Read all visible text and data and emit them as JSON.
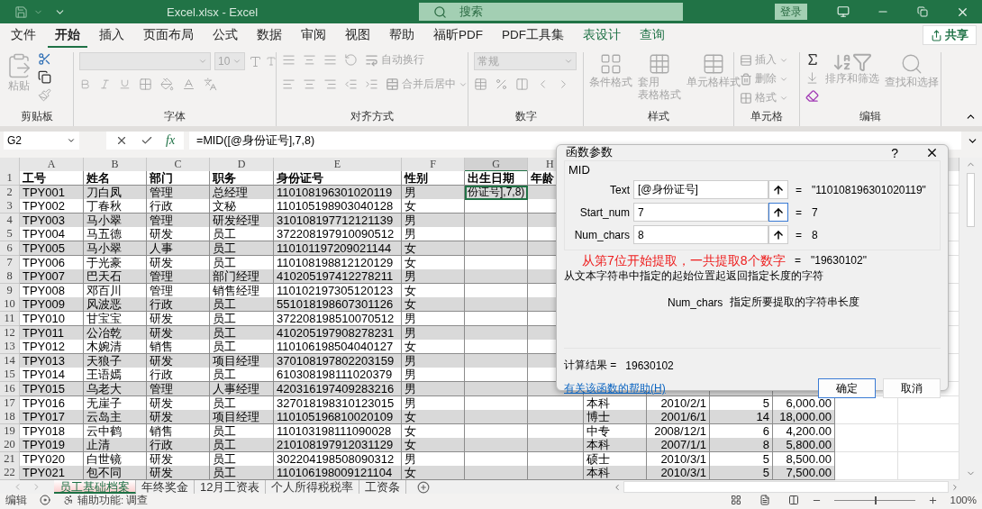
{
  "title_bar": {
    "title": "Excel.xlsx  -  Excel",
    "search": {
      "placeholder": "搜索"
    },
    "sign_in": "登录"
  },
  "menu": {
    "tabs": [
      {
        "label": "文件",
        "selected": false,
        "contextual": false
      },
      {
        "label": "开始",
        "selected": true,
        "contextual": false
      },
      {
        "label": "插入",
        "selected": false,
        "contextual": false
      },
      {
        "label": "页面布局",
        "selected": false,
        "contextual": false
      },
      {
        "label": "公式",
        "selected": false,
        "contextual": false
      },
      {
        "label": "数据",
        "selected": false,
        "contextual": false
      },
      {
        "label": "审阅",
        "selected": false,
        "contextual": false
      },
      {
        "label": "视图",
        "selected": false,
        "contextual": false
      },
      {
        "label": "帮助",
        "selected": false,
        "contextual": false
      },
      {
        "label": "福昕PDF",
        "selected": false,
        "contextual": false
      },
      {
        "label": "PDF工具集",
        "selected": false,
        "contextual": false
      },
      {
        "label": "表设计",
        "selected": false,
        "contextual": true
      },
      {
        "label": "查询",
        "selected": false,
        "contextual": true
      }
    ],
    "share": "共享"
  },
  "ribbon": {
    "groups": [
      {
        "kind": "clipboard",
        "title": "剪贴板",
        "paste": "粘贴",
        "disabled": true
      },
      {
        "kind": "font",
        "title": "字体",
        "size": "10",
        "disabled": true
      },
      {
        "kind": "alignment",
        "title": "对齐方式",
        "wrap": "自动换行",
        "merge": "合并后居中",
        "disabled": true
      },
      {
        "kind": "number",
        "title": "数字",
        "format": "常规",
        "disabled": true
      },
      {
        "kind": "styles",
        "title": "样式",
        "buttons": [
          [
            "条件格式"
          ],
          [
            "套用",
            "表格格式"
          ],
          [
            "单元格样式"
          ]
        ],
        "disabled": true
      },
      {
        "kind": "cells",
        "title": "单元格",
        "buttons": [
          "插入",
          "删除",
          "格式"
        ],
        "disabled": true
      },
      {
        "kind": "editing",
        "title": "编辑",
        "sort": "排序和筛选",
        "find": "查找和选择",
        "disabled": true
      }
    ]
  },
  "formula_bar": {
    "name_box": "G2",
    "fx": "fx",
    "formula": "=MID([@身份证号],7,8)"
  },
  "sheet": {
    "columns": [
      {
        "label": "A",
        "selected": false
      },
      {
        "label": "B",
        "selected": false
      },
      {
        "label": "C",
        "selected": false
      },
      {
        "label": "D",
        "selected": false
      },
      {
        "label": "E",
        "selected": false
      },
      {
        "label": "F",
        "selected": false
      },
      {
        "label": "G",
        "selected": true
      },
      {
        "label": "H",
        "selected": false
      }
    ],
    "rows": [
      {
        "number": "1",
        "kind": "header",
        "cells": [
          "工号",
          "姓名",
          "部门",
          "职务",
          "身份证号",
          "性别",
          "出生日期",
          "年龄"
        ]
      },
      {
        "number": "2",
        "kind": "data",
        "cells": [
          "TPY001",
          "刀白凤",
          "管理",
          "总经理",
          "110108196301020119",
          "男",
          {
            "text": "份证号],7,8)",
            "active": true
          },
          null
        ]
      },
      {
        "number": "3",
        "kind": "data",
        "cells": [
          "TPY002",
          "丁春秋",
          "行政",
          "文秘",
          "110105198903040128",
          "女",
          null,
          null
        ]
      },
      {
        "number": "4",
        "kind": "data",
        "cells": [
          "TPY003",
          "马小翠",
          "管理",
          "研发经理",
          "310108197712121139",
          "男",
          null,
          null
        ]
      },
      {
        "number": "5",
        "kind": "data",
        "cells": [
          "TPY004",
          "马五德",
          "研发",
          "员工",
          "372208197910090512",
          "男",
          null,
          null
        ]
      },
      {
        "number": "6",
        "kind": "data",
        "cells": [
          "TPY005",
          "马小翠",
          "人事",
          "员工",
          "110101197209021144",
          "女",
          null,
          null
        ]
      },
      {
        "number": "7",
        "kind": "data",
        "cells": [
          "TPY006",
          "于光豪",
          "研发",
          "员工",
          "110108198812120129",
          "女",
          null,
          null
        ]
      },
      {
        "number": "8",
        "kind": "data",
        "cells": [
          "TPY007",
          "巴天石",
          "管理",
          "部门经理",
          "410205197412278211",
          "男",
          null,
          null
        ]
      },
      {
        "number": "9",
        "kind": "data",
        "cells": [
          "TPY008",
          "邓百川",
          "管理",
          "销售经理",
          "110102197305120123",
          "女",
          null,
          null
        ]
      },
      {
        "number": "10",
        "kind": "data",
        "cells": [
          "TPY009",
          "风波恶",
          "行政",
          "员工",
          "551018198607301126",
          "女",
          null,
          null
        ]
      },
      {
        "number": "11",
        "kind": "data",
        "cells": [
          "TPY010",
          "甘宝宝",
          "研发",
          "员工",
          "372208198510070512",
          "男",
          null,
          null
        ]
      },
      {
        "number": "12",
        "kind": "data",
        "cells": [
          "TPY011",
          "公冶乾",
          "研发",
          "员工",
          "410205197908278231",
          "男",
          null,
          null
        ]
      },
      {
        "number": "13",
        "kind": "data",
        "cells": [
          "TPY012",
          "木婉清",
          "销售",
          "员工",
          "110106198504040127",
          "女",
          null,
          null
        ]
      },
      {
        "number": "14",
        "kind": "data",
        "cells": [
          "TPY013",
          "天狼子",
          "研发",
          "项目经理",
          "370108197802203159",
          "男",
          null,
          null
        ]
      },
      {
        "number": "15",
        "kind": "data",
        "cells": [
          "TPY014",
          "王语嫣",
          "行政",
          "员工",
          "610308198111020379",
          "男",
          null,
          null
        ]
      },
      {
        "number": "16",
        "kind": "data",
        "cells": [
          "TPY015",
          "乌老大",
          "管理",
          "人事经理",
          "420316197409283216",
          "男",
          null,
          null
        ]
      },
      {
        "number": "17",
        "kind": "data",
        "cells": [
          "TPY016",
          "无崖子",
          "研发",
          "员工",
          "327018198310123015",
          "男",
          null,
          null
        ],
        "more": [
          "本科",
          "2010/2/1",
          "5",
          "6,000.00"
        ]
      },
      {
        "number": "18",
        "kind": "data",
        "cells": [
          "TPY017",
          "云岛主",
          "研发",
          "项目经理",
          "110105196810020109",
          "女",
          null,
          null
        ],
        "more": [
          "博士",
          "2001/6/1",
          "14",
          "18,000.00"
        ]
      },
      {
        "number": "19",
        "kind": "data",
        "cells": [
          "TPY018",
          "云中鹤",
          "销售",
          "员工",
          "110103198111090028",
          "女",
          null,
          null
        ],
        "more": [
          "中专",
          "2008/12/1",
          "6",
          "4,200.00"
        ]
      },
      {
        "number": "20",
        "kind": "data",
        "cells": [
          "TPY019",
          "止清",
          "行政",
          "员工",
          "210108197912031129",
          "女",
          null,
          null
        ],
        "more": [
          "本科",
          "2007/1/1",
          "8",
          "5,800.00"
        ]
      },
      {
        "number": "21",
        "kind": "data",
        "cells": [
          "TPY020",
          "白世镜",
          "研发",
          "员工",
          "302204198508090312",
          "男",
          null,
          null
        ],
        "more": [
          "硕士",
          "2010/3/1",
          "5",
          "8,500.00"
        ]
      },
      {
        "number": "22",
        "kind": "data",
        "cells": [
          "TPY021",
          "包不同",
          "研发",
          "员工",
          "110106198009121104",
          "女",
          null,
          null
        ],
        "more": [
          "本科",
          "2010/3/1",
          "5",
          "7,500.00"
        ]
      }
    ]
  },
  "sheet_tabs": [
    {
      "label": "员工基础档案",
      "selected": true
    },
    {
      "label": "年终奖金",
      "selected": false
    },
    {
      "label": "12月工资表",
      "selected": false
    },
    {
      "label": "个人所得税税率",
      "selected": false
    },
    {
      "label": "工资条",
      "selected": false
    }
  ],
  "status_bar": {
    "mode": "编辑",
    "accessibility": "辅助功能: 调查",
    "zoom": "100%",
    "zoom_level": {
      "level": 0.5
    }
  },
  "dialog": {
    "title": "函数参数",
    "help": "?",
    "function_name": "MID",
    "arguments": [
      {
        "label": "Text",
        "value": "[@身份证号]",
        "sign": "=",
        "result": "\"110108196301020119\"",
        "focused": false
      },
      {
        "label": "Start_num",
        "value": "7",
        "sign": "=",
        "result": "7",
        "focused": true
      },
      {
        "label": "Num_chars",
        "value": "8",
        "sign": "=",
        "result": "8",
        "focused": false
      }
    ],
    "note": "从第7位开始提取，一共提取8个数字",
    "formula_sign": "=",
    "formula_result": "\"19630102\"",
    "description": "从文本字符串中指定的起始位置起返回指定长度的字符",
    "argument_help": {
      "name": "Num_chars",
      "text": "指定所要提取的字符串长度"
    },
    "result_label": "计算结果 =",
    "result": "19630102",
    "help_link": "有关该函数的帮助(H)",
    "buttons": [
      {
        "label": "确定",
        "default": true
      },
      {
        "label": "取消",
        "default": false
      }
    ]
  }
}
